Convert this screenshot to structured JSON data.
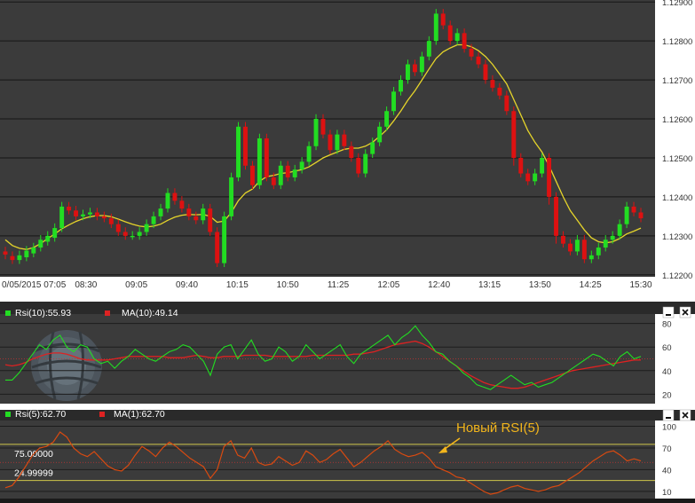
{
  "chart_data": [
    {
      "type": "candlestick",
      "title": "",
      "price_axis": {
        "ticks": [
          "1.12900",
          "1.12800",
          "1.12700",
          "1.12600",
          "1.12500",
          "1.12400",
          "1.12300",
          "1.12200"
        ],
        "ylim": [
          1.12195,
          1.12905
        ]
      },
      "time_axis": {
        "labels": [
          "0/05/2015 07:05",
          "08:30",
          "09:05",
          "09:40",
          "10:15",
          "10:50",
          "11:25",
          "12:05",
          "12:40",
          "13:15",
          "13:50",
          "14:25",
          "15:30"
        ]
      },
      "candles": [
        [
          1.1226,
          1.12252,
          1.1224
        ],
        [
          1.12248,
          1.12238,
          1.12235
        ],
        [
          1.12238,
          1.1225,
          1.12245
        ],
        [
          1.12245,
          1.12262,
          1.12255
        ],
        [
          1.12255,
          1.1227,
          1.1227
        ],
        [
          1.1227,
          1.1229,
          1.12285
        ],
        [
          1.12285,
          1.123,
          1.12295
        ],
        [
          1.12295,
          1.1232,
          1.1233
        ],
        [
          1.1232,
          1.12375,
          1.1238
        ],
        [
          1.12375,
          1.12365,
          1.1236
        ],
        [
          1.12365,
          1.1235,
          1.12345
        ],
        [
          1.1235,
          1.12355,
          1.1236
        ],
        [
          1.12355,
          1.1236,
          1.1236
        ],
        [
          1.1236,
          1.1235,
          1.12345
        ],
        [
          1.1235,
          1.12345,
          1.1234
        ],
        [
          1.12345,
          1.1233,
          1.1232
        ],
        [
          1.1233,
          1.1231,
          1.12305
        ],
        [
          1.1231,
          1.123,
          1.1229
        ],
        [
          1.123,
          1.123,
          1.12295
        ],
        [
          1.123,
          1.1231,
          1.12305
        ],
        [
          1.1231,
          1.1233,
          1.12325
        ],
        [
          1.1233,
          1.1235,
          1.12345
        ],
        [
          1.1235,
          1.1237,
          1.12365
        ],
        [
          1.1237,
          1.1241,
          1.124
        ],
        [
          1.1241,
          1.1239,
          1.1238
        ],
        [
          1.1239,
          1.1237,
          1.12365
        ],
        [
          1.1237,
          1.1235,
          1.12345
        ],
        [
          1.1235,
          1.1234,
          1.1233
        ],
        [
          1.1234,
          1.1237,
          1.12365
        ],
        [
          1.1237,
          1.1231,
          1.123
        ],
        [
          1.1231,
          1.1223,
          1.1222
        ],
        [
          1.1223,
          1.1235,
          1.1234
        ],
        [
          1.1235,
          1.1245,
          1.1244
        ],
        [
          1.1245,
          1.1258,
          1.1257
        ],
        [
          1.1258,
          1.1248,
          1.1247
        ],
        [
          1.1248,
          1.1243,
          1.1242
        ],
        [
          1.1243,
          1.1255,
          1.1255
        ],
        [
          1.1255,
          1.1245,
          1.1244
        ],
        [
          1.1245,
          1.1243,
          1.1242
        ],
        [
          1.1243,
          1.1248,
          1.1247
        ],
        [
          1.1248,
          1.1245,
          1.1245
        ],
        [
          1.1245,
          1.1247,
          1.12465
        ],
        [
          1.1247,
          1.1249,
          1.12485
        ],
        [
          1.1249,
          1.1253,
          1.12525
        ],
        [
          1.1253,
          1.126,
          1.126
        ],
        [
          1.126,
          1.1256,
          1.1255
        ],
        [
          1.1256,
          1.1252,
          1.1251
        ],
        [
          1.1252,
          1.1256,
          1.12555
        ],
        [
          1.1256,
          1.1253,
          1.1252
        ],
        [
          1.1253,
          1.125,
          1.1249
        ],
        [
          1.125,
          1.1246,
          1.1245
        ],
        [
          1.1246,
          1.1251,
          1.125
        ],
        [
          1.1251,
          1.1254,
          1.12535
        ],
        [
          1.1254,
          1.1258,
          1.1257
        ],
        [
          1.1258,
          1.1262,
          1.1261
        ],
        [
          1.1262,
          1.1267,
          1.1266
        ],
        [
          1.1267,
          1.127,
          1.1269
        ],
        [
          1.127,
          1.1274,
          1.1273
        ],
        [
          1.1274,
          1.1272,
          1.1271
        ],
        [
          1.1272,
          1.1276,
          1.1275
        ],
        [
          1.1276,
          1.128,
          1.1279
        ],
        [
          1.128,
          1.1287,
          1.1286
        ],
        [
          1.1287,
          1.1284,
          1.1283
        ],
        [
          1.1284,
          1.128,
          1.1279
        ],
        [
          1.128,
          1.1282,
          1.12815
        ],
        [
          1.1282,
          1.1278,
          1.1277
        ],
        [
          1.1278,
          1.1276,
          1.12755
        ],
        [
          1.1276,
          1.1274,
          1.1273
        ],
        [
          1.1274,
          1.127,
          1.1269
        ],
        [
          1.127,
          1.1268,
          1.1267
        ],
        [
          1.1268,
          1.1266,
          1.1265
        ],
        [
          1.1266,
          1.1262,
          1.1261
        ],
        [
          1.1262,
          1.125,
          1.1248
        ],
        [
          1.125,
          1.1246,
          1.1245
        ],
        [
          1.1246,
          1.1244,
          1.1243
        ],
        [
          1.1244,
          1.1246,
          1.12455
        ],
        [
          1.1246,
          1.125,
          1.125
        ],
        [
          1.125,
          1.124,
          1.1238
        ],
        [
          1.124,
          1.123,
          1.1228
        ],
        [
          1.123,
          1.1228,
          1.1227
        ],
        [
          1.1228,
          1.1226,
          1.1225
        ],
        [
          1.1226,
          1.1229,
          1.12285
        ],
        [
          1.1229,
          1.1224,
          1.12235
        ],
        [
          1.1224,
          1.1225,
          1.12245
        ],
        [
          1.1225,
          1.1227,
          1.12265
        ],
        [
          1.1227,
          1.1229,
          1.12285
        ],
        [
          1.1229,
          1.123,
          1.123
        ],
        [
          1.123,
          1.1233,
          1.12325
        ],
        [
          1.1233,
          1.12375,
          1.1237
        ],
        [
          1.12375,
          1.1236,
          1.12355
        ],
        [
          1.1236,
          1.12345,
          1.1234
        ]
      ],
      "ma_values": [
        1.1229,
        1.12275,
        1.12268,
        1.12265,
        1.1227,
        1.1228,
        1.12293,
        1.12305,
        1.12318,
        1.12328,
        1.12337,
        1.12344,
        1.12349,
        1.12352,
        1.12352,
        1.12349,
        1.12343,
        1.12336,
        1.1233,
        1.12325,
        1.12323,
        1.12325,
        1.1233,
        1.1234,
        1.12348,
        1.12353,
        1.12355,
        1.12354,
        1.12355,
        1.1235,
        1.12335,
        1.12338,
        1.1236,
        1.1239,
        1.1241,
        1.1242,
        1.1244,
        1.12452,
        1.12455,
        1.1246,
        1.12462,
        1.12466,
        1.1247,
        1.12477,
        1.12488,
        1.125,
        1.12508,
        1.12515,
        1.12522,
        1.12525,
        1.12525,
        1.1253,
        1.1254,
        1.12555,
        1.12572,
        1.12595,
        1.1262,
        1.12648,
        1.12672,
        1.127,
        1.12728,
        1.12755,
        1.12772,
        1.12782,
        1.1279,
        1.1279,
        1.12785,
        1.12775,
        1.1276,
        1.1274,
        1.12715,
        1.1269,
        1.1265,
        1.1261,
        1.1257,
        1.1254,
        1.12515,
        1.1248,
        1.1244,
        1.124,
        1.12365,
        1.1234,
        1.12315,
        1.12295,
        1.12285,
        1.12282,
        1.12285,
        1.12293,
        1.12305,
        1.12312,
        1.1232
      ],
      "up_color": "#22dd22",
      "down_color": "#dd1111",
      "ma_color": "#e6d52a"
    },
    {
      "type": "line",
      "title": "",
      "legend": [
        {
          "name": "Rsi(10):55.93",
          "color": "#22dd22"
        },
        {
          "name": "MA(10):49.14",
          "color": "#dd2222"
        }
      ],
      "y_ticks": [
        "80",
        "60",
        "40",
        "20"
      ],
      "ylim": [
        12,
        88
      ],
      "reference_line": 50,
      "series": [
        {
          "name": "Rsi(10)",
          "values": [
            32,
            32,
            38,
            46,
            54,
            62,
            58,
            66,
            70,
            60,
            56,
            62,
            60,
            50,
            46,
            48,
            42,
            48,
            52,
            58,
            54,
            50,
            48,
            52,
            56,
            58,
            62,
            60,
            54,
            48,
            36,
            54,
            60,
            62,
            50,
            58,
            66,
            54,
            48,
            50,
            60,
            56,
            48,
            52,
            62,
            56,
            50,
            54,
            58,
            62,
            52,
            46,
            54,
            58,
            62,
            66,
            70,
            62,
            68,
            72,
            78,
            70,
            64,
            56,
            54,
            48,
            44,
            38,
            34,
            28,
            26,
            24,
            28,
            32,
            36,
            32,
            28,
            30,
            26,
            28,
            30,
            34,
            38,
            42,
            46,
            50,
            54,
            52,
            48,
            44,
            52,
            56,
            50,
            52
          ]
        },
        {
          "name": "MA(10)",
          "values": [
            45,
            44,
            45,
            47,
            50,
            52,
            54,
            55,
            55,
            54,
            52,
            50,
            49,
            49,
            49,
            49,
            50,
            51,
            52,
            52,
            52,
            52,
            52,
            52,
            51,
            51,
            51,
            52,
            53,
            52,
            51,
            51,
            52,
            52,
            52,
            53,
            53,
            53,
            53,
            52,
            52,
            52,
            52,
            52,
            52,
            53,
            53,
            53,
            53,
            53,
            53,
            54,
            54,
            55,
            56,
            58,
            60,
            62,
            63,
            64,
            65,
            63,
            60,
            56,
            52,
            48,
            44,
            40,
            36,
            33,
            30,
            28,
            27,
            26,
            25,
            25,
            26,
            28,
            30,
            32,
            34,
            36,
            38,
            40,
            41,
            42,
            43,
            44,
            45,
            46,
            47,
            48,
            49,
            49
          ]
        }
      ]
    },
    {
      "type": "line",
      "title": "",
      "legend": [
        {
          "name": "Rsi(5):62.70",
          "color": "#22dd22"
        },
        {
          "name": "MA(1):62.70",
          "color": "#dd2222"
        }
      ],
      "y_ticks": [
        "100",
        "70",
        "40",
        "10"
      ],
      "ylim": [
        0,
        108
      ],
      "levels": [
        {
          "value": 75,
          "label": "75.00000"
        },
        {
          "value": 24.99999,
          "label": "24.99999"
        }
      ],
      "reference_line": 50,
      "annotation": "Новый RSI(5)",
      "series": [
        {
          "name": "RSI(5)",
          "values": [
            15,
            18,
            30,
            45,
            60,
            70,
            72,
            78,
            92,
            85,
            70,
            62,
            58,
            65,
            55,
            45,
            40,
            38,
            46,
            60,
            72,
            66,
            58,
            70,
            78,
            72,
            64,
            56,
            50,
            44,
            28,
            40,
            72,
            80,
            60,
            56,
            70,
            50,
            46,
            48,
            58,
            52,
            46,
            50,
            66,
            60,
            50,
            54,
            62,
            68,
            56,
            44,
            50,
            58,
            66,
            72,
            80,
            68,
            62,
            58,
            60,
            64,
            56,
            44,
            40,
            36,
            30,
            28,
            22,
            16,
            10,
            6,
            8,
            12,
            16,
            18,
            14,
            12,
            10,
            12,
            16,
            18,
            24,
            30,
            36,
            44,
            52,
            58,
            64,
            66,
            60,
            52,
            55,
            52
          ]
        }
      ],
      "line_color": "#d94a10",
      "level_color": "#cfc64a"
    }
  ]
}
